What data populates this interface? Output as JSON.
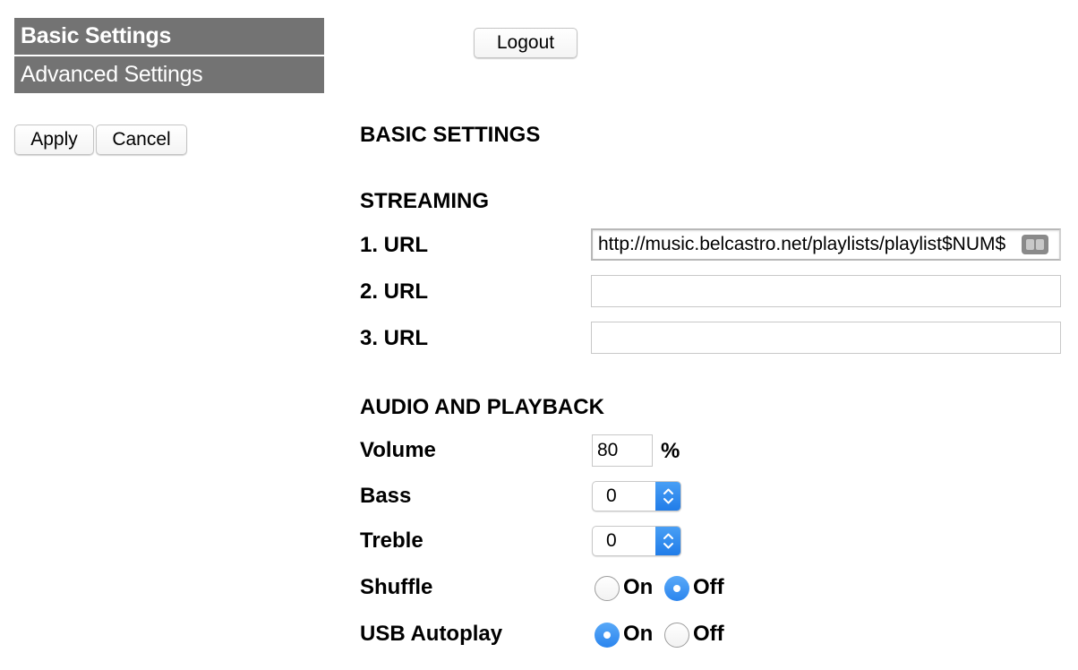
{
  "nav": {
    "items": [
      {
        "label": "Basic Settings",
        "active": true
      },
      {
        "label": "Advanced Settings",
        "active": false
      }
    ]
  },
  "header": {
    "logout_label": "Logout"
  },
  "actions": {
    "apply_label": "Apply",
    "cancel_label": "Cancel"
  },
  "main": {
    "title": "BASIC SETTINGS",
    "streaming": {
      "heading": "STREAMING",
      "urls": [
        {
          "label": "1. URL",
          "value": "http://music.belcastro.net/playlists/playlist$NUM$"
        },
        {
          "label": "2. URL",
          "value": ""
        },
        {
          "label": "3. URL",
          "value": ""
        }
      ]
    },
    "audio": {
      "heading": "AUDIO AND PLAYBACK",
      "volume": {
        "label": "Volume",
        "value": "80",
        "unit": "%"
      },
      "bass": {
        "label": "Bass",
        "value": "0"
      },
      "treble": {
        "label": "Treble",
        "value": "0"
      },
      "shuffle": {
        "label": "Shuffle",
        "on_label": "On",
        "off_label": "Off",
        "selected": "Off"
      },
      "usb_autoplay": {
        "label": "USB Autoplay",
        "on_label": "On",
        "off_label": "Off",
        "selected": "On"
      }
    }
  },
  "colors": {
    "nav_background": "#737373",
    "accent_blue": "#2b85ee"
  },
  "icons": {
    "select_arrows": "chevron-up-down-icon",
    "autofill": "contacts-autofill-icon"
  }
}
